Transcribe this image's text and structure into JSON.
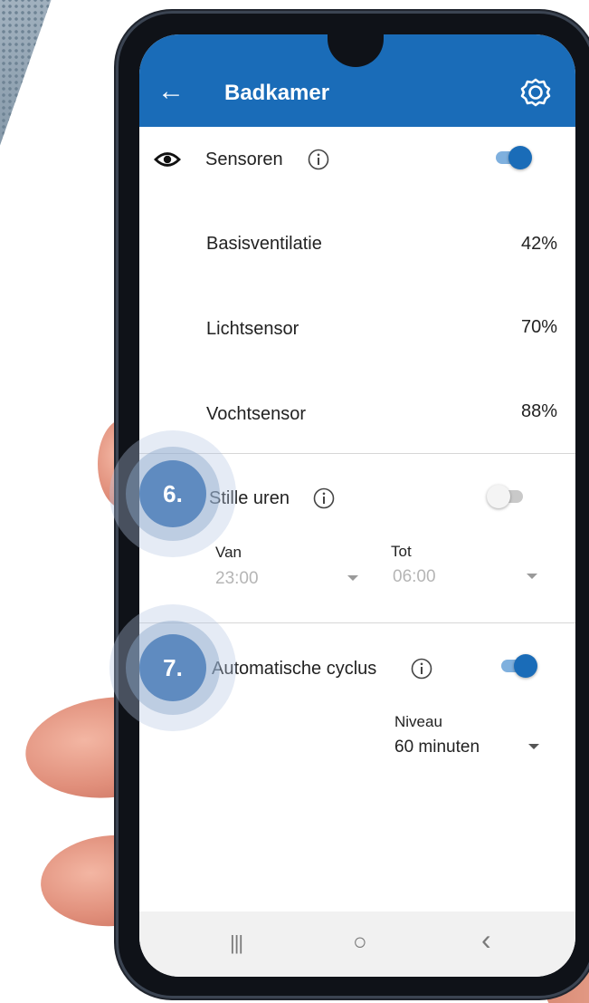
{
  "header": {
    "back_icon": "back-arrow-icon",
    "title": "Badkamer",
    "settings_icon": "gear-icon",
    "color": "#1a6cb8"
  },
  "sensors": {
    "icon": "eye-icon",
    "label": "Sensoren",
    "info_icon": "info-icon",
    "toggle_on": true,
    "rows": [
      {
        "label": "Basisventilatie",
        "value": "42%"
      },
      {
        "label": "Lichtsensor",
        "value": "70%"
      },
      {
        "label": "Vochtsensor",
        "value": "88%"
      }
    ]
  },
  "quiet_hours": {
    "callout": "6.",
    "icon": "moon-icon",
    "label": "Stille uren",
    "info_icon": "info-icon",
    "toggle_on": false,
    "from_label": "Van",
    "from_value": "23:00",
    "to_label": "Tot",
    "to_value": "06:00"
  },
  "auto_cycle": {
    "callout": "7.",
    "icon": "cycle-icon",
    "label": "Automatische cyclus",
    "info_icon": "info-icon",
    "toggle_on": true,
    "level_label": "Niveau",
    "level_value": "60 minuten"
  },
  "navbar": {
    "recents": "|||",
    "home": "○",
    "back": "‹"
  }
}
